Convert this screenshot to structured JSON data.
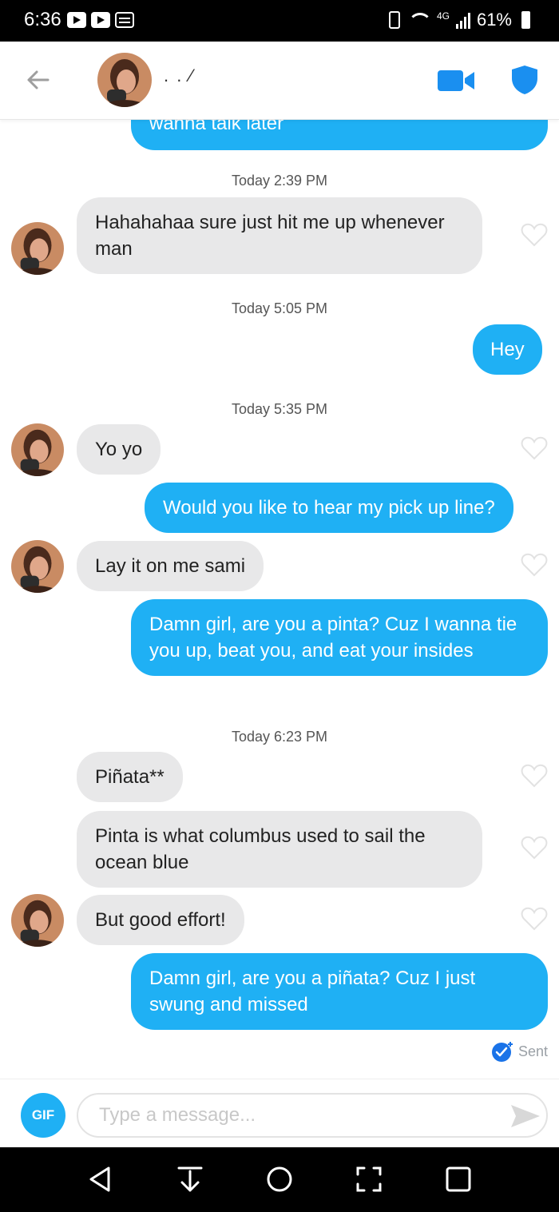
{
  "status_bar": {
    "time": "6:36",
    "network": "4G",
    "battery": "61%"
  },
  "header": {
    "contact_name": ". .        ⁄",
    "icons": [
      "back-arrow-icon",
      "video-call-icon",
      "safety-shield-icon"
    ]
  },
  "colors": {
    "accent_blue": "#1fb0f4",
    "incoming_bubble": "#e8e8e9",
    "status_bar": "#000000"
  },
  "messages": [
    {
      "from": "me",
      "text": "wanna talk later"
    },
    {
      "timestamp": "Today 2:39 PM"
    },
    {
      "from": "them",
      "text": "Hahahahaa sure just hit me up whenever man"
    },
    {
      "timestamp": "Today 5:05 PM"
    },
    {
      "from": "me",
      "text": "Hey"
    },
    {
      "timestamp": "Today 5:35 PM"
    },
    {
      "from": "them",
      "text": "Yo yo"
    },
    {
      "from": "me",
      "text": "Would you like to hear my pick up line?"
    },
    {
      "from": "them",
      "text": "Lay it on me sami"
    },
    {
      "from": "me",
      "text": "Damn girl, are you a pinta? Cuz I wanna tie you up, beat you, and eat your insides"
    },
    {
      "timestamp": "Today 6:23 PM"
    },
    {
      "from": "them",
      "text": "Piñata**"
    },
    {
      "from": "them",
      "text": "Pinta is what columbus used to sail the ocean blue"
    },
    {
      "from": "them",
      "text": "But good effort!"
    },
    {
      "from": "me",
      "text": "Damn girl, are you a piñata? Cuz I just swung and missed"
    }
  ],
  "sent_status": "Sent",
  "compose": {
    "gif_label": "GIF",
    "placeholder": "Type a message..."
  }
}
